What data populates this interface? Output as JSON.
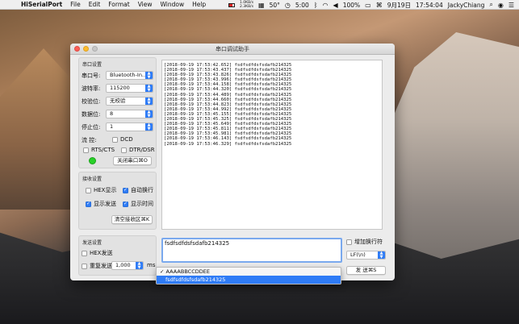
{
  "menubar": {
    "app_name": "HiSerialPort",
    "menus": [
      "File",
      "Edit",
      "Format",
      "View",
      "Window",
      "Help"
    ],
    "net_up": "1.0KB/s",
    "net_down": "2.3KB/s",
    "temp": "50°",
    "time": "5:00",
    "battery": "100%",
    "date": "9月19日",
    "clock": "17:54:04",
    "user": "JackyChiang"
  },
  "window": {
    "title": "串口调试助手"
  },
  "serial_settings": {
    "title": "串口设置",
    "port_label": "串口号:",
    "port_value": "Bluetooth-In...",
    "baud_label": "波特率:",
    "baud_value": "115200",
    "parity_label": "校验位:",
    "parity_value": "无校验",
    "databits_label": "数据位:",
    "databits_value": "8",
    "stopbits_label": "停止位:",
    "stopbits_value": "1",
    "flow_label": "流   控:",
    "dcd_label": "DCD",
    "rtscts_label": "RTS/CTS",
    "dtrdsr_label": "DTR/DSR",
    "close_port_button": "关闭串口⌘O"
  },
  "receive_settings": {
    "title": "接收设置",
    "hex_display": "HEX显示",
    "auto_newline": "自动换行",
    "show_send": "显示发送",
    "show_time": "显示时间",
    "clear_button": "清空接收区⌘K"
  },
  "receive_log": [
    "[2018-09-19 17:53:42.652] fsdfsdfdsfsdafb214325",
    "[2018-09-19 17:53:43.437] fsdfsdfdsfsdafb214325",
    "[2018-09-19 17:53:43.826] fsdfsdfdsfsdafb214325",
    "[2018-09-19 17:53:43.996] fsdfsdfdsfsdafb214325",
    "[2018-09-19 17:53:44.158] fsdfsdfdsfsdafb214325",
    "[2018-09-19 17:53:44.320] fsdfsdfdsfsdafb214325",
    "[2018-09-19 17:53:44.489] fsdfsdfdsfsdafb214325",
    "[2018-09-19 17:53:44.660] fsdfsdfdsfsdafb214325",
    "[2018-09-19 17:53:44.823] fsdfsdfdsfsdafb214325",
    "[2018-09-19 17:53:44.992] fsdfsdfdsfsdafb214325",
    "[2018-09-19 17:53:45.155] fsdfsdfdsfsdafb214325",
    "[2018-09-19 17:53:45.325] fsdfsdfdsfsdafb214325",
    "[2018-09-19 17:53:45.649] fsdfsdfdsfsdafb214325",
    "[2018-09-19 17:53:45.811] fsdfsdfdsfsdafb214325",
    "[2018-09-19 17:53:45.981] fsdfsdfdsfsdafb214325",
    "[2018-09-19 17:53:46.143] fsdfsdfdsfsdafb214325",
    "[2018-09-19 17:53:46.329] fsdfsdfdsfsdafb214325"
  ],
  "send_settings": {
    "title": "发送设置",
    "hex_send": "HEX发送",
    "repeat_send": "重复发送",
    "interval_value": "1,000",
    "interval_unit": "ms",
    "send_text": "fsdfsdfdsfsdafb214325",
    "add_newline": "增加换行符",
    "newline_value": "LF(\\n)",
    "send_button": "发   送⌘S"
  },
  "history_dropdown": {
    "options": [
      "AAAABBCCDDEE",
      "fsdfsdfdsfsdafb214325"
    ],
    "checkmark": "✓"
  }
}
